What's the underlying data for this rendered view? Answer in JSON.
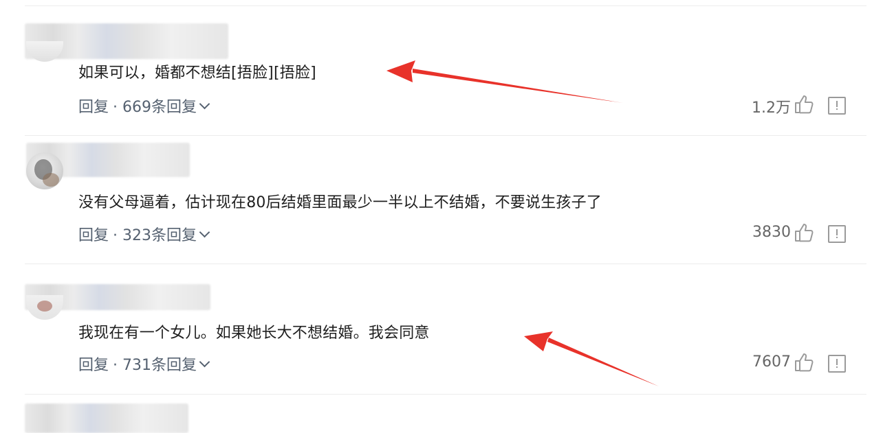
{
  "comments": [
    {
      "text": "如果可以，婚都不想结[捂脸][捂脸]",
      "reply_label": "回复",
      "reply_count": "· 669条回复",
      "likes": "1.2万"
    },
    {
      "text": "没有父母逼着，估计现在80后结婚里面最少一半以上不结婚，不要说生孩子了",
      "reply_label": "回复",
      "reply_count": "· 323条回复",
      "likes": "3830"
    },
    {
      "text": "我现在有一个女儿。如果她长大不想结婚。我会同意",
      "reply_label": "回复",
      "reply_count": "· 731条回复",
      "likes": "7607"
    }
  ],
  "icons": {
    "like": "thumbs-up-icon",
    "report": "report-icon",
    "expand": "chevron-down-icon"
  },
  "colors": {
    "annotation_arrow": "#e8322a",
    "reply_link": "#556170",
    "divider": "#ececec"
  }
}
